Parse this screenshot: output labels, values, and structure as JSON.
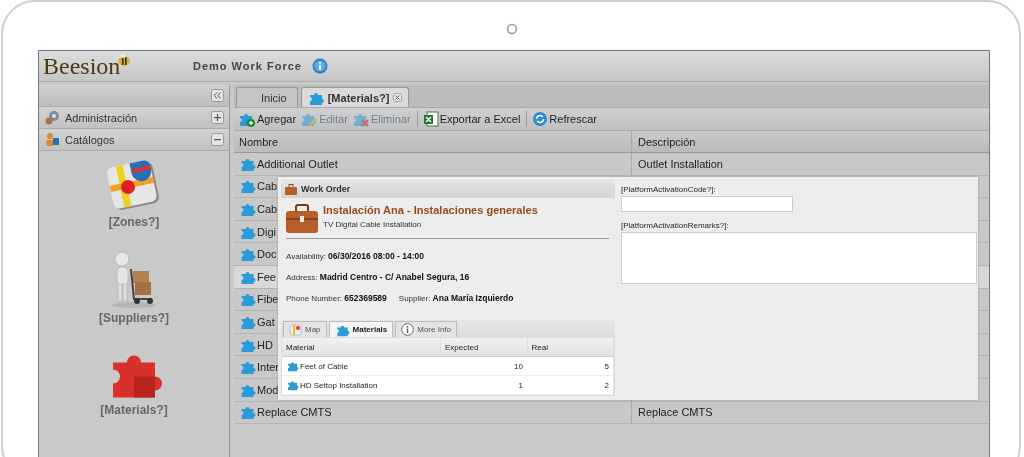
{
  "header": {
    "logo": "Beesion",
    "app_title": "Demo Work Force"
  },
  "sidebar": {
    "sections": [
      {
        "label": "Administración",
        "expanded": false,
        "kind": "admin"
      },
      {
        "label": "Catálogos",
        "expanded": true,
        "kind": "catalog"
      }
    ],
    "catalog_items": [
      {
        "label": "[Zones?]",
        "kind": "map"
      },
      {
        "label": "[Suppliers?]",
        "kind": "supplier"
      },
      {
        "label": "[Materials?]",
        "kind": "puzzle"
      }
    ]
  },
  "tabs": [
    {
      "label": "Inicio",
      "selected": false,
      "closable": false
    },
    {
      "label": "[Materials?]",
      "selected": true,
      "closable": true
    }
  ],
  "toolbar": [
    {
      "label": "Agregar",
      "kind": "add",
      "disabled": false,
      "separator_before": false
    },
    {
      "label": "Editar",
      "kind": "edit",
      "disabled": true,
      "separator_before": false
    },
    {
      "label": "Eliminar",
      "kind": "delete",
      "disabled": true,
      "separator_before": false
    },
    {
      "label": "Exportar a Excel",
      "kind": "excel",
      "disabled": false,
      "separator_before": true
    },
    {
      "label": "Refrescar",
      "kind": "refresh",
      "disabled": false,
      "separator_before": true
    }
  ],
  "grid": {
    "columns": [
      "Nombre",
      "Descripción"
    ],
    "rows": [
      {
        "name": "Additional Outlet",
        "description": "Outlet Installation",
        "selected": false
      },
      {
        "name": "Cab",
        "selected": false
      },
      {
        "name": "Cab",
        "selected": false
      },
      {
        "name": "Digi",
        "selected": false
      },
      {
        "name": "Doc",
        "selected": false
      },
      {
        "name": "Fee",
        "selected": true
      },
      {
        "name": "Fibe",
        "selected": false
      },
      {
        "name": "Gat",
        "selected": false
      },
      {
        "name": "HD",
        "selected": false
      },
      {
        "name": "Inter",
        "selected": false
      },
      {
        "name": "Mod",
        "selected": false
      },
      {
        "name": "Replace CMTS",
        "description": "Replace CMTS",
        "selected": false
      }
    ]
  },
  "dialog": {
    "title": "Work Order",
    "heading": "Instalación Ana - Instalaciones generales",
    "subheading": "TV Digital Cable Installation",
    "field_rows": [
      [
        {
          "label": "Availability:",
          "value": "06/30/2016 08:00 - 14:00"
        }
      ],
      [
        {
          "label": "Address:",
          "value": "Madrid Centro - C/ Anabel Segura, 16"
        }
      ],
      [
        {
          "label": "Phone Number:",
          "value": "652369589"
        },
        {
          "label": "Supplier:",
          "value": "Ana María Izquierdo"
        }
      ]
    ],
    "tabs": [
      {
        "label": "Map",
        "kind": "map",
        "selected": false
      },
      {
        "label": "Materials",
        "kind": "puzzle",
        "selected": true
      },
      {
        "label": "More Info",
        "kind": "info",
        "selected": false
      }
    ],
    "materials": {
      "columns": [
        "Material",
        "Expected",
        "Real"
      ],
      "rows": [
        {
          "material": "Feet of Cable",
          "expected": "10",
          "real": "5"
        },
        {
          "material": "HD Settop Installation",
          "expected": "1",
          "real": "2"
        }
      ]
    },
    "form": [
      {
        "label": "[PlatformActivationCode?]:",
        "kind": "input"
      },
      {
        "label": "[PlatformActivationRemarks?]:",
        "kind": "textarea"
      }
    ]
  }
}
